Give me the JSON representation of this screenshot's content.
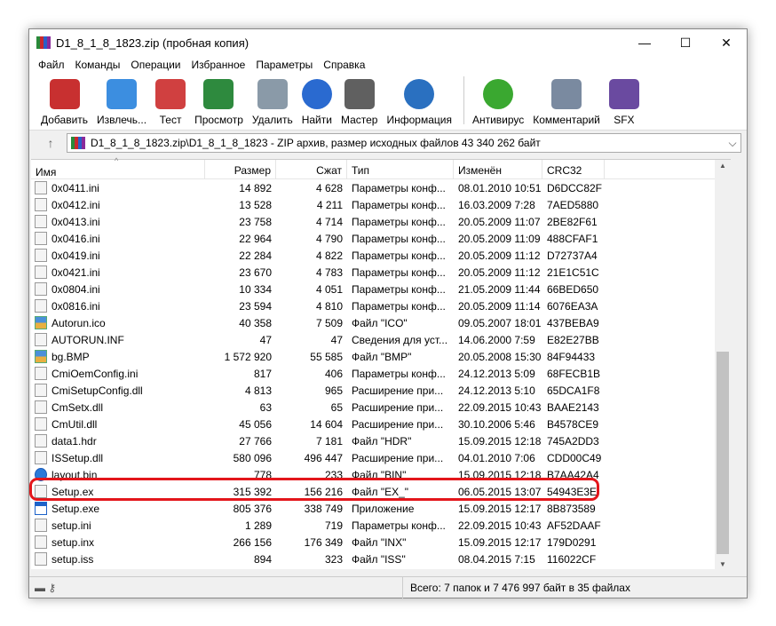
{
  "window": {
    "title": "D1_8_1_8_1823.zip (пробная копия)",
    "controls": [
      "—",
      "☐",
      "✕"
    ]
  },
  "menu": [
    "Файл",
    "Команды",
    "Операции",
    "Избранное",
    "Параметры",
    "Справка"
  ],
  "toolbar": [
    {
      "label": "Добавить",
      "icon": "archive-add-icon",
      "color": "#c83030"
    },
    {
      "label": "Извлечь...",
      "icon": "extract-folder-icon",
      "color": "#3c8ee0"
    },
    {
      "label": "Тест",
      "icon": "test-clipboard-icon",
      "color": "#d04040"
    },
    {
      "label": "Просмотр",
      "icon": "view-book-icon",
      "color": "#2e8a3e"
    },
    {
      "label": "Удалить",
      "icon": "delete-trash-icon",
      "color": "#8a9aa8"
    },
    {
      "label": "Найти",
      "icon": "find-magnifier-icon",
      "color": "#2a6ad0"
    },
    {
      "label": "Мастер",
      "icon": "wizard-wand-icon",
      "color": "#606060"
    },
    {
      "label": "Информация",
      "icon": "info-icon",
      "color": "#2a70c0"
    },
    {
      "label": "Антивирус",
      "icon": "antivirus-icon",
      "color": "#3aa830"
    },
    {
      "label": "Комментарий",
      "icon": "comment-icon",
      "color": "#7a8aa0"
    },
    {
      "label": "SFX",
      "icon": "sfx-icon",
      "color": "#6a4aa0"
    }
  ],
  "address": "D1_8_1_8_1823.zip\\D1_8_1_8_1823 - ZIP архив, размер исходных файлов 43 340 262 байт",
  "columns": [
    "Имя",
    "Размер",
    "Сжат",
    "Тип",
    "Изменён",
    "CRC32"
  ],
  "rows": [
    [
      "0x0411.ini",
      "14 892",
      "4 628",
      "Параметры конф...",
      "08.01.2010 10:51",
      "D6DCC82F",
      "ini"
    ],
    [
      "0x0412.ini",
      "13 528",
      "4 211",
      "Параметры конф...",
      "16.03.2009 7:28",
      "7AED5880",
      "ini"
    ],
    [
      "0x0413.ini",
      "23 758",
      "4 714",
      "Параметры конф...",
      "20.05.2009 11:07",
      "2BE82F61",
      "ini"
    ],
    [
      "0x0416.ini",
      "22 964",
      "4 790",
      "Параметры конф...",
      "20.05.2009 11:09",
      "488CFAF1",
      "ini"
    ],
    [
      "0x0419.ini",
      "22 284",
      "4 822",
      "Параметры конф...",
      "20.05.2009 11:12",
      "D72737A4",
      "ini"
    ],
    [
      "0x0421.ini",
      "23 670",
      "4 783",
      "Параметры конф...",
      "20.05.2009 11:12",
      "21E1C51C",
      "ini"
    ],
    [
      "0x0804.ini",
      "10 334",
      "4 051",
      "Параметры конф...",
      "21.05.2009 11:44",
      "66BED650",
      "ini"
    ],
    [
      "0x0816.ini",
      "23 594",
      "4 810",
      "Параметры конф...",
      "20.05.2009 11:14",
      "6076EA3A",
      "ini"
    ],
    [
      "Autorun.ico",
      "40 358",
      "7 509",
      "Файл \"ICO\"",
      "09.05.2007 18:01",
      "437BEBA9",
      "img"
    ],
    [
      "AUTORUN.INF",
      "47",
      "47",
      "Сведения для уст...",
      "14.06.2000 7:59",
      "E82E27BB",
      "ini"
    ],
    [
      "bg.BMP",
      "1 572 920",
      "55 585",
      "Файл \"BMP\"",
      "20.05.2008 15:30",
      "84F94433",
      "img"
    ],
    [
      "CmiOemConfig.ini",
      "817",
      "406",
      "Параметры конф...",
      "24.12.2013 5:09",
      "68FECB1B",
      "ini"
    ],
    [
      "CmiSetupConfig.dll",
      "4 813",
      "965",
      "Расширение при...",
      "24.12.2013 5:10",
      "65DCA1F8",
      "ini"
    ],
    [
      "CmSetx.dll",
      "63",
      "65",
      "Расширение при...",
      "22.09.2015 10:43",
      "BAAE2143",
      "ini"
    ],
    [
      "CmUtil.dll",
      "45 056",
      "14 604",
      "Расширение при...",
      "30.10.2006 5:46",
      "B4578CE9",
      "ini"
    ],
    [
      "data1.hdr",
      "27 766",
      "7 181",
      "Файл \"HDR\"",
      "15.09.2015 12:18",
      "745A2DD3",
      "file"
    ],
    [
      "ISSetup.dll",
      "580 096",
      "496 447",
      "Расширение при...",
      "04.01.2010 7:06",
      "CDD00C49",
      "ini"
    ],
    [
      "layout.bin",
      "778",
      "233",
      "Файл \"BIN\"",
      "15.09.2015 12:18",
      "B7AA42A4",
      "blue"
    ],
    [
      "Setup.ex",
      "315 392",
      "156 216",
      "Файл \"EX_\"",
      "06.05.2015 13:07",
      "54943E3E",
      "file"
    ],
    [
      "Setup.exe",
      "805 376",
      "338 749",
      "Приложение",
      "15.09.2015 12:17",
      "8B873589",
      "exe"
    ],
    [
      "setup.ini",
      "1 289",
      "719",
      "Параметры конф...",
      "22.09.2015 10:43",
      "AF52DAAF",
      "ini"
    ],
    [
      "setup.inx",
      "266 156",
      "176 349",
      "Файл \"INX\"",
      "15.09.2015 12:17",
      "179D0291",
      "file"
    ],
    [
      "setup.iss",
      "894",
      "323",
      "Файл \"ISS\"",
      "08.04.2015 7:15",
      "116022CF",
      "file"
    ]
  ],
  "highlight_color": "#e3161b",
  "status": {
    "total": "Всего: 7 папок и 7 476 997 байт в 35 файлах"
  }
}
